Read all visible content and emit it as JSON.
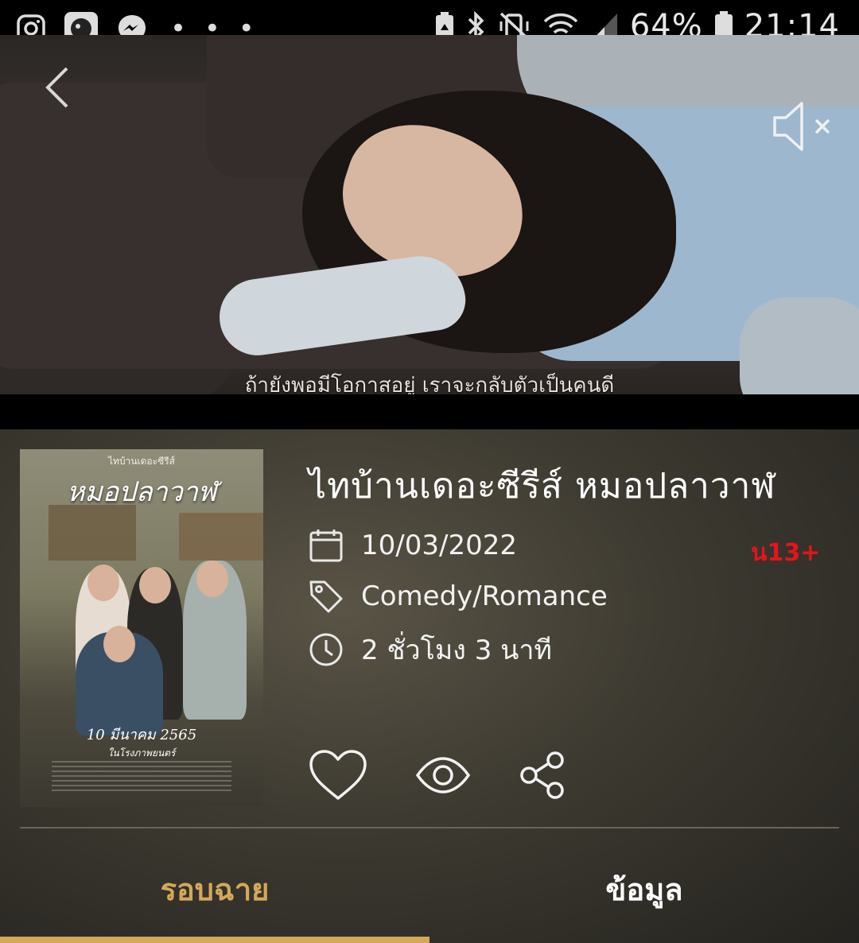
{
  "status_bar": {
    "battery": "64%",
    "time": "21:14",
    "overflow": "• • •"
  },
  "video": {
    "subtitle": "ถ้ายังพอมีโอกาสอยู่ เราจะกลับตัวเป็นคนดี"
  },
  "poster": {
    "top_line": "ไทบ้านเดอะซีรีส์",
    "title": "หมอปลาวาฬ",
    "date": "10  มีนาคม 2565",
    "date_sub": "ในโรงภาพยนตร์"
  },
  "movie": {
    "title": "ไทบ้านเดอะซีรีส์ หมอปลาวาฬ",
    "release_date": "10/03/2022",
    "genre": "Comedy/Romance",
    "duration": "2 ชั่วโมง 3 นาที",
    "rating": "น13+"
  },
  "tabs": {
    "showtimes": "รอบฉาย",
    "info": "ข้อมูล"
  },
  "colors": {
    "accent_gold": "#d4a85a",
    "rating_red": "#e4141b",
    "tab_active_underline": "#d4a85a"
  },
  "icons": {
    "back": "chevron-left-icon",
    "mute": "speaker-muted-icon",
    "date": "calendar-icon",
    "genre": "tag-icon",
    "duration": "clock-icon",
    "favorite": "heart-icon",
    "watch": "eye-icon",
    "share": "share-icon"
  }
}
